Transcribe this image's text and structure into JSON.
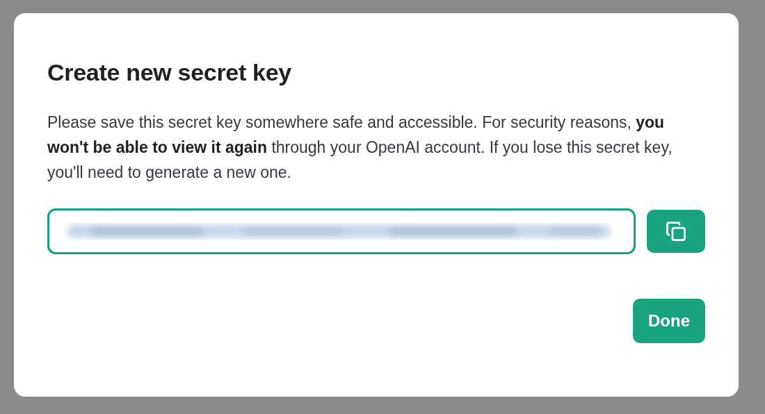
{
  "dialog": {
    "title": "Create new secret key",
    "message": "Please save this secret key somewhere safe and accessible. For security reasons, **you won't be able to view it again** through your OpenAI account. If you lose this secret key, you'll need to generate a new one.",
    "key_field": {
      "focused": true
    },
    "buttons": [
      {
        "kind": "copy"
      },
      {
        "kind": "text",
        "label": "Done"
      }
    ]
  }
}
